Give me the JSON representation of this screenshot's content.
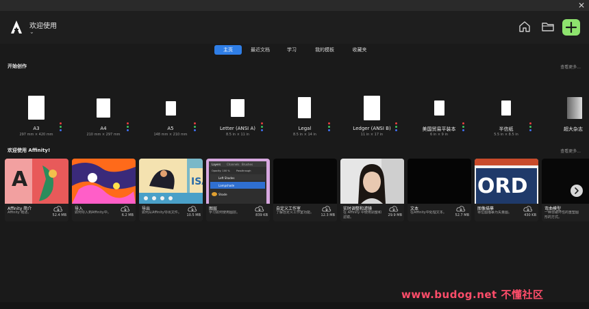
{
  "header": {
    "welcome": "欢迎使用",
    "chevron": "⌄",
    "close": "✕"
  },
  "tabs": [
    {
      "label": "主页",
      "active": true
    },
    {
      "label": "最近文档",
      "active": false
    },
    {
      "label": "学习",
      "active": false
    },
    {
      "label": "我的模板",
      "active": false
    },
    {
      "label": "收藏夹",
      "active": false
    }
  ],
  "sections": {
    "start": {
      "title": "开始创作",
      "see_more": "查看更多..."
    },
    "welcome": {
      "title": "欢迎使用 Affinity!",
      "see_more": "查看更多..."
    }
  },
  "presets": [
    {
      "name": "A3",
      "size": "297 mm × 420 mm"
    },
    {
      "name": "A4",
      "size": "210 mm × 297 mm"
    },
    {
      "name": "A5",
      "size": "148 mm × 210 mm"
    },
    {
      "name": "Letter (ANSI A)",
      "size": "8.5 in × 11 in"
    },
    {
      "name": "Legal",
      "size": "8.5 in × 14 in"
    },
    {
      "name": "Ledger (ANSI B)",
      "size": "11 in × 17 in"
    },
    {
      "name": "美国贸易平装本",
      "size": "6 in × 9 in"
    },
    {
      "name": "半信纸",
      "size": "5.5 in × 8.5 in"
    },
    {
      "name": "超大杂志",
      "size": ""
    }
  ],
  "cards": [
    {
      "title": "Affinity 简介",
      "desc": "Affinity 概述。",
      "size": "52.4 MB"
    },
    {
      "title": "导入",
      "desc": "如何导入到Affinity中。",
      "size": "6.2 MB"
    },
    {
      "title": "导出",
      "desc": "如何从Affinity导出文件。",
      "size": "10.5 MB"
    },
    {
      "title": "图层",
      "desc": "学习如何使用图层。",
      "size": "839 KB"
    },
    {
      "title": "自定义工作室",
      "desc": "了解自定义工作室功能。",
      "size": "12.3 MB"
    },
    {
      "title": "实时调整和滤镜",
      "desc": "在 Affinity 中使用调整和滤镜。",
      "size": "29.9 MB"
    },
    {
      "title": "文本",
      "desc": "在Affinity中处理文本。",
      "size": "52.7 MB"
    },
    {
      "title": "图像描摹",
      "desc": "将位图描摹为矢量图。",
      "size": "430 KB"
    },
    {
      "title": "弯曲模型",
      "desc": "一种非破坏性的重塑图形的方式。",
      "size": ""
    }
  ],
  "layers_panel": {
    "tabs": [
      "Layers",
      "Channels",
      "Brushes"
    ],
    "opacity": "Opacity: 100 %",
    "blend": "Passthrough",
    "rows": [
      "Left Shades",
      "Lampshade",
      "Shade"
    ]
  },
  "watermark": "www.budog.net 不懂社区",
  "colors": {
    "accent": "#2f7ee6",
    "plus": "#8ee36e"
  }
}
